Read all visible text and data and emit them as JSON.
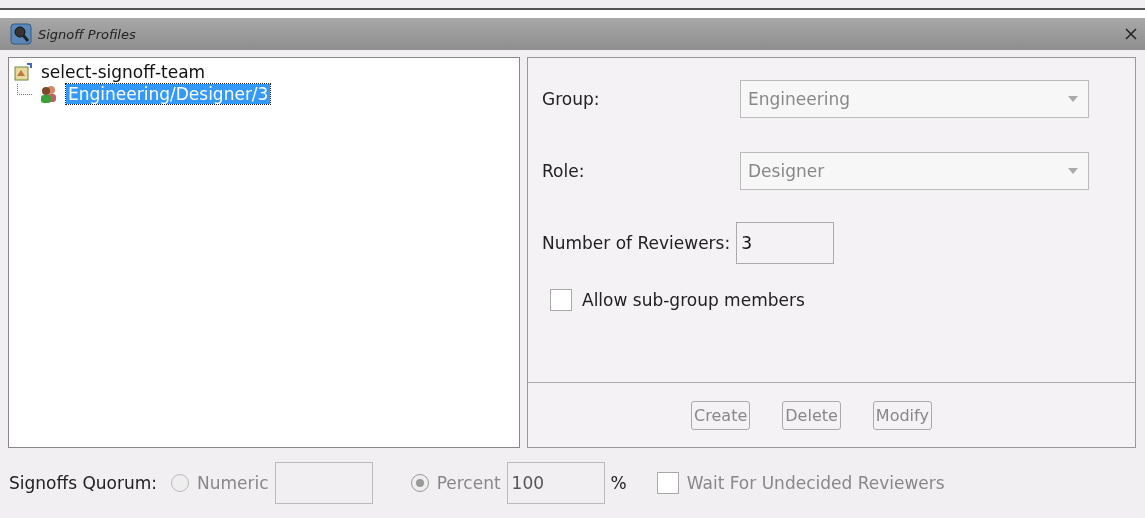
{
  "window": {
    "title": "Signoff Profiles"
  },
  "tree": {
    "label": "select-signoff-team",
    "expanded": true,
    "children": [
      {
        "label": "Engineering/Designer/3",
        "selected": true
      }
    ]
  },
  "form": {
    "fields": [
      {
        "kind": "combo",
        "label": "Group:",
        "value": "Engineering",
        "disabled": true
      },
      {
        "kind": "combo",
        "label": "Role:",
        "value": "Designer",
        "disabled": true
      },
      {
        "kind": "text",
        "label": "Number of Reviewers:",
        "value": "3",
        "disabled": false
      }
    ],
    "allow_subgroup": {
      "label": "Allow sub-group members",
      "checked": false
    }
  },
  "buttons": [
    {
      "label": "Create",
      "disabled": true
    },
    {
      "label": "Delete",
      "disabled": true
    },
    {
      "label": "Modify",
      "disabled": true
    }
  ],
  "quorum": {
    "label": "Signoffs Quorum:",
    "options": [
      {
        "label": "Numeric",
        "selected": false
      },
      {
        "label": "Percent",
        "selected": true,
        "value": "100",
        "suffix": "%"
      }
    ],
    "wait": {
      "label": "Wait For Undecided Reviewers",
      "checked": false
    }
  }
}
